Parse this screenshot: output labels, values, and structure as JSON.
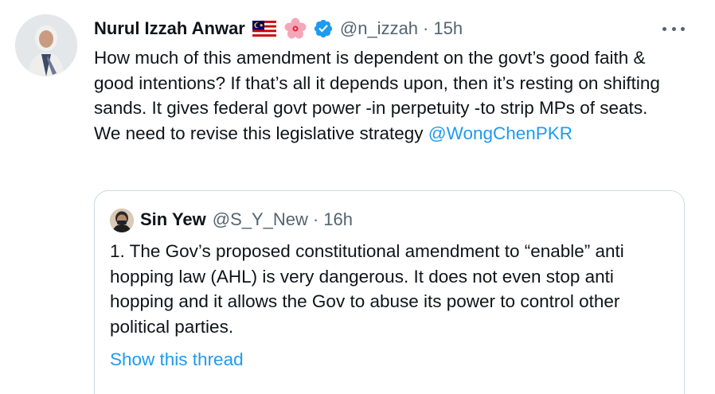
{
  "tweet": {
    "display_name": "Nurul Izzah Anwar",
    "handle": "@n_izzah",
    "separator": "·",
    "time": "15h",
    "text": "How much of this amendment is dependent on the govt’s good faith & good intentions? If that’s all it depends upon, then it’s resting on shifting sands. It gives federal govt power -in perpetuity -to strip MPs of seats. We need to revise this legislative strategy ",
    "mention": "@WongChenPKR",
    "icons": [
      "malaysia-flag-icon",
      "hibiscus-icon",
      "verified-badge-icon",
      "more-options-icon"
    ]
  },
  "quoted_tweet": {
    "display_name": "Sin Yew",
    "handle": "@S_Y_New",
    "separator": "·",
    "time": "16h",
    "text": "1. The Gov’s proposed constitutional amendment to “enable” anti hopping law (AHL) is very dangerous. It does not even stop anti hopping and it allows the Gov to abuse its power to control other political parties.",
    "show_thread_label": "Show this thread"
  },
  "colors": {
    "text_primary": "#0f1419",
    "text_secondary": "#536471",
    "link": "#1d9bf0",
    "border": "#cfd9de",
    "background": "#ffffff"
  }
}
